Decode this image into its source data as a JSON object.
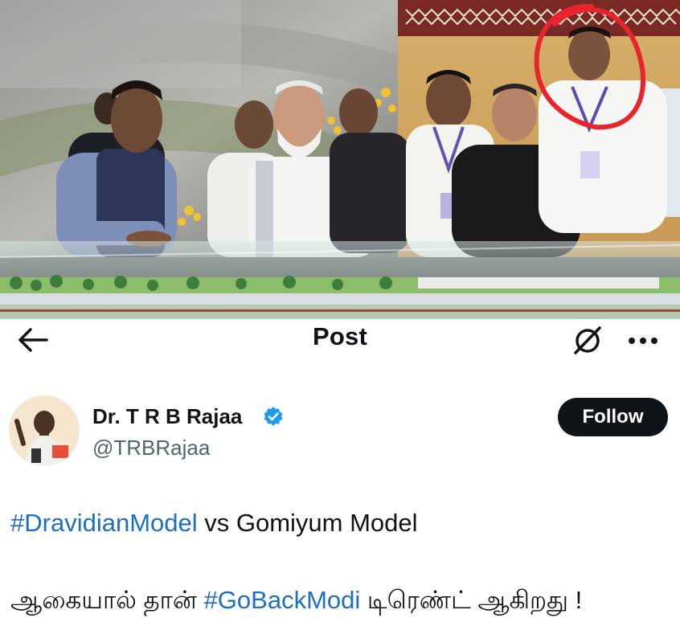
{
  "photo": {
    "description_icon": "photo-of-event-model-display"
  },
  "header": {
    "back_icon": "back-arrow-icon",
    "title": "Post",
    "grok_icon": "grok-icon",
    "more_icon": "more-options-icon"
  },
  "author": {
    "name": "Dr. T R B Rajaa",
    "handle": "@TRBRajaa",
    "verified": true,
    "verified_color": "#1d9bf0",
    "follow_label": "Follow"
  },
  "post": {
    "line1": {
      "hashtag": "#DravidianModel",
      "text": " vs Gomiyum Model"
    },
    "line2": {
      "prefix": "ஆகையால் தான் ",
      "hashtag": "#GoBackModi",
      "suffix": " டிரெண்ட் ஆகிறது !"
    }
  },
  "colors": {
    "hashtag": "#1d6fbf",
    "text": "#0f1419",
    "secondary": "#536471",
    "follow_bg": "#0f1419",
    "circle_annotation": "#e8242c"
  }
}
